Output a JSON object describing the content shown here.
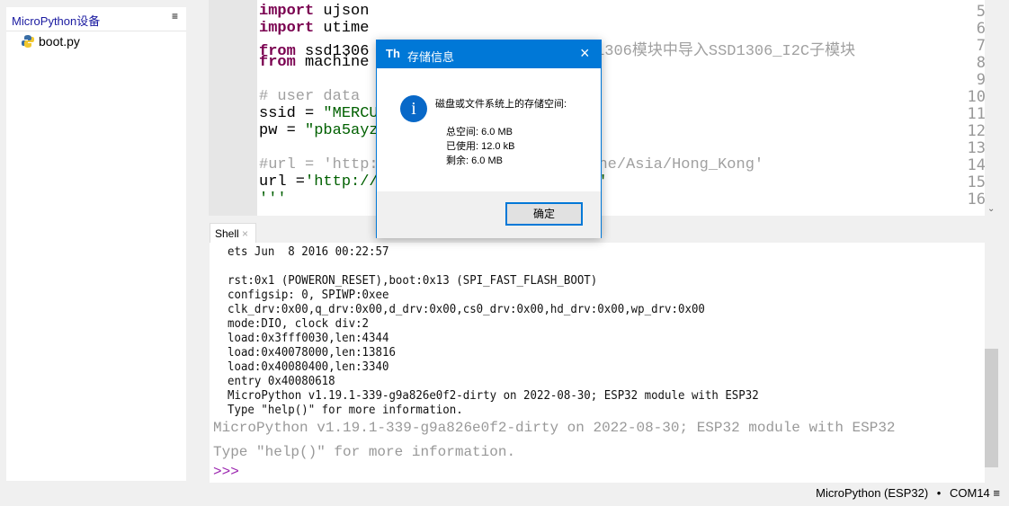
{
  "files_panel": {
    "title": "MicroPython设备",
    "menu_icon": "hamburger-icon",
    "files": [
      {
        "name": "boot.py",
        "icon": "python-file-icon"
      }
    ]
  },
  "editor": {
    "lines": [
      {
        "n": "5",
        "parts": [
          [
            "kw",
            "import"
          ],
          [
            "",
            "ujson"
          ]
        ]
      },
      {
        "n": "6",
        "parts": [
          [
            "kw",
            "import"
          ],
          [
            "",
            "utime"
          ]
        ]
      },
      {
        "n": "7",
        "parts": [
          [
            "kw",
            "from"
          ],
          [
            "",
            "ssd1306"
          ],
          [
            "cm",
            "                    从ssd1306模块中导入SSD1306_I2C子模块"
          ]
        ]
      },
      {
        "n": "8",
        "parts": [
          [
            "kw",
            "from"
          ],
          [
            "",
            "machine"
          ]
        ]
      },
      {
        "n": "9",
        "parts": []
      },
      {
        "n": "10",
        "parts": [
          [
            "cm",
            "# user data"
          ]
        ]
      },
      {
        "n": "11",
        "parts": [
          [
            "",
            "ssid = "
          ],
          [
            "st",
            "\"MERCU"
          ],
          [
            "cm",
            "                    ame"
          ]
        ]
      },
      {
        "n": "12",
        "parts": [
          [
            "",
            "pw = "
          ],
          [
            "st",
            "\"pba5ayz"
          ]
        ]
      },
      {
        "n": "13",
        "parts": []
      },
      {
        "n": "14",
        "parts": [
          [
            "cm",
            "#url = 'http:                    mezone/Asia/Hong_Kong'"
          ]
        ]
      },
      {
        "n": "15",
        "parts": [
          [
            "",
            "url ="
          ],
          [
            "st",
            "'http://                    e.do'"
          ]
        ]
      },
      {
        "n": "16",
        "parts": [
          [
            "st",
            "'''"
          ]
        ]
      }
    ]
  },
  "shell": {
    "tab_label": "Shell",
    "log": [
      "ets Jun  8 2016 00:22:57",
      "",
      "rst:0x1 (POWERON_RESET),boot:0x13 (SPI_FAST_FLASH_BOOT)",
      "configsip: 0, SPIWP:0xee",
      "clk_drv:0x00,q_drv:0x00,d_drv:0x00,cs0_drv:0x00,hd_drv:0x00,wp_drv:0x00",
      "mode:DIO, clock div:2",
      "load:0x3fff0030,len:4344",
      "load:0x40078000,len:13816",
      "load:0x40080400,len:3340",
      "entry 0x40080618",
      "MicroPython v1.19.1-339-g9a826e0f2-dirty on 2022-08-30; ESP32 module with ESP32",
      "Type \"help()\" for more information."
    ],
    "banner": [
      "MicroPython v1.19.1-339-g9a826e0f2-dirty on 2022-08-30; ESP32 module with ESP32",
      "Type \"help()\" for more information."
    ],
    "prompt": ">>>"
  },
  "dialog": {
    "title": "存储信息",
    "message": "磁盘或文件系统上的存储空间:",
    "total": "总空间: 6.0 MB",
    "used": "已使用: 12.0 kB",
    "free": "剩余: 6.0 MB",
    "ok": "确定",
    "accent": "#0078d7"
  },
  "status": {
    "interpreter": "MicroPython (ESP32)",
    "separator": "•",
    "port": "COM14"
  }
}
